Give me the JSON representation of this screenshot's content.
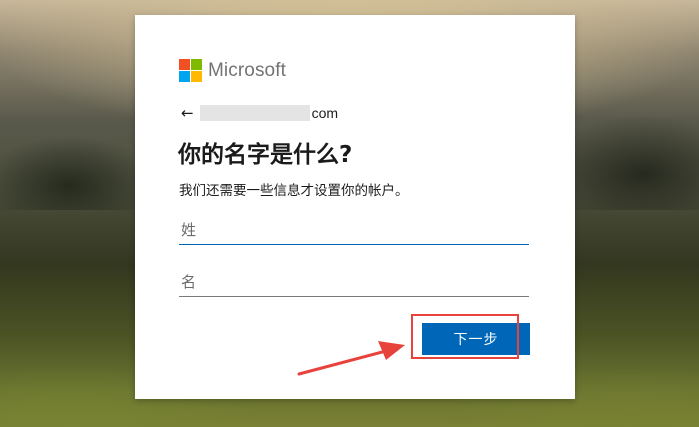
{
  "brand": {
    "name": "Microsoft"
  },
  "identity": {
    "back_icon": "←",
    "email_visible_suffix": "com"
  },
  "form": {
    "title": "你的名字是什么?",
    "subtitle": "我们还需要一些信息才设置你的帐户。",
    "last_name_placeholder": "姓",
    "first_name_placeholder": "名",
    "last_name_value": "",
    "first_name_value": ""
  },
  "actions": {
    "next_label": "下一步"
  },
  "annotation": {
    "color": "#e8423c"
  }
}
